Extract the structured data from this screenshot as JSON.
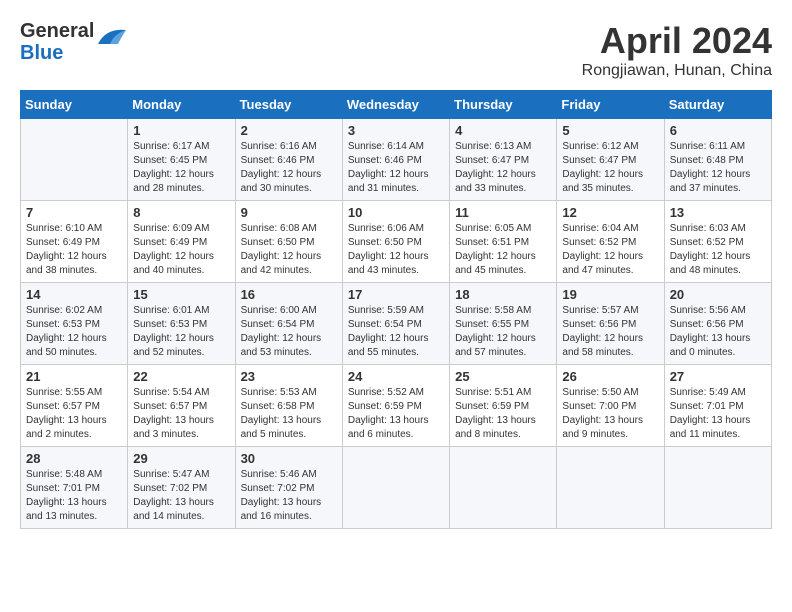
{
  "header": {
    "logo_general": "General",
    "logo_blue": "Blue",
    "month": "April 2024",
    "location": "Rongjiawan, Hunan, China"
  },
  "columns": [
    "Sunday",
    "Monday",
    "Tuesday",
    "Wednesday",
    "Thursday",
    "Friday",
    "Saturday"
  ],
  "weeks": [
    [
      {
        "day": "",
        "info": ""
      },
      {
        "day": "1",
        "info": "Sunrise: 6:17 AM\nSunset: 6:45 PM\nDaylight: 12 hours\nand 28 minutes."
      },
      {
        "day": "2",
        "info": "Sunrise: 6:16 AM\nSunset: 6:46 PM\nDaylight: 12 hours\nand 30 minutes."
      },
      {
        "day": "3",
        "info": "Sunrise: 6:14 AM\nSunset: 6:46 PM\nDaylight: 12 hours\nand 31 minutes."
      },
      {
        "day": "4",
        "info": "Sunrise: 6:13 AM\nSunset: 6:47 PM\nDaylight: 12 hours\nand 33 minutes."
      },
      {
        "day": "5",
        "info": "Sunrise: 6:12 AM\nSunset: 6:47 PM\nDaylight: 12 hours\nand 35 minutes."
      },
      {
        "day": "6",
        "info": "Sunrise: 6:11 AM\nSunset: 6:48 PM\nDaylight: 12 hours\nand 37 minutes."
      }
    ],
    [
      {
        "day": "7",
        "info": "Sunrise: 6:10 AM\nSunset: 6:49 PM\nDaylight: 12 hours\nand 38 minutes."
      },
      {
        "day": "8",
        "info": "Sunrise: 6:09 AM\nSunset: 6:49 PM\nDaylight: 12 hours\nand 40 minutes."
      },
      {
        "day": "9",
        "info": "Sunrise: 6:08 AM\nSunset: 6:50 PM\nDaylight: 12 hours\nand 42 minutes."
      },
      {
        "day": "10",
        "info": "Sunrise: 6:06 AM\nSunset: 6:50 PM\nDaylight: 12 hours\nand 43 minutes."
      },
      {
        "day": "11",
        "info": "Sunrise: 6:05 AM\nSunset: 6:51 PM\nDaylight: 12 hours\nand 45 minutes."
      },
      {
        "day": "12",
        "info": "Sunrise: 6:04 AM\nSunset: 6:52 PM\nDaylight: 12 hours\nand 47 minutes."
      },
      {
        "day": "13",
        "info": "Sunrise: 6:03 AM\nSunset: 6:52 PM\nDaylight: 12 hours\nand 48 minutes."
      }
    ],
    [
      {
        "day": "14",
        "info": "Sunrise: 6:02 AM\nSunset: 6:53 PM\nDaylight: 12 hours\nand 50 minutes."
      },
      {
        "day": "15",
        "info": "Sunrise: 6:01 AM\nSunset: 6:53 PM\nDaylight: 12 hours\nand 52 minutes."
      },
      {
        "day": "16",
        "info": "Sunrise: 6:00 AM\nSunset: 6:54 PM\nDaylight: 12 hours\nand 53 minutes."
      },
      {
        "day": "17",
        "info": "Sunrise: 5:59 AM\nSunset: 6:54 PM\nDaylight: 12 hours\nand 55 minutes."
      },
      {
        "day": "18",
        "info": "Sunrise: 5:58 AM\nSunset: 6:55 PM\nDaylight: 12 hours\nand 57 minutes."
      },
      {
        "day": "19",
        "info": "Sunrise: 5:57 AM\nSunset: 6:56 PM\nDaylight: 12 hours\nand 58 minutes."
      },
      {
        "day": "20",
        "info": "Sunrise: 5:56 AM\nSunset: 6:56 PM\nDaylight: 13 hours\nand 0 minutes."
      }
    ],
    [
      {
        "day": "21",
        "info": "Sunrise: 5:55 AM\nSunset: 6:57 PM\nDaylight: 13 hours\nand 2 minutes."
      },
      {
        "day": "22",
        "info": "Sunrise: 5:54 AM\nSunset: 6:57 PM\nDaylight: 13 hours\nand 3 minutes."
      },
      {
        "day": "23",
        "info": "Sunrise: 5:53 AM\nSunset: 6:58 PM\nDaylight: 13 hours\nand 5 minutes."
      },
      {
        "day": "24",
        "info": "Sunrise: 5:52 AM\nSunset: 6:59 PM\nDaylight: 13 hours\nand 6 minutes."
      },
      {
        "day": "25",
        "info": "Sunrise: 5:51 AM\nSunset: 6:59 PM\nDaylight: 13 hours\nand 8 minutes."
      },
      {
        "day": "26",
        "info": "Sunrise: 5:50 AM\nSunset: 7:00 PM\nDaylight: 13 hours\nand 9 minutes."
      },
      {
        "day": "27",
        "info": "Sunrise: 5:49 AM\nSunset: 7:01 PM\nDaylight: 13 hours\nand 11 minutes."
      }
    ],
    [
      {
        "day": "28",
        "info": "Sunrise: 5:48 AM\nSunset: 7:01 PM\nDaylight: 13 hours\nand 13 minutes."
      },
      {
        "day": "29",
        "info": "Sunrise: 5:47 AM\nSunset: 7:02 PM\nDaylight: 13 hours\nand 14 minutes."
      },
      {
        "day": "30",
        "info": "Sunrise: 5:46 AM\nSunset: 7:02 PM\nDaylight: 13 hours\nand 16 minutes."
      },
      {
        "day": "",
        "info": ""
      },
      {
        "day": "",
        "info": ""
      },
      {
        "day": "",
        "info": ""
      },
      {
        "day": "",
        "info": ""
      }
    ]
  ]
}
